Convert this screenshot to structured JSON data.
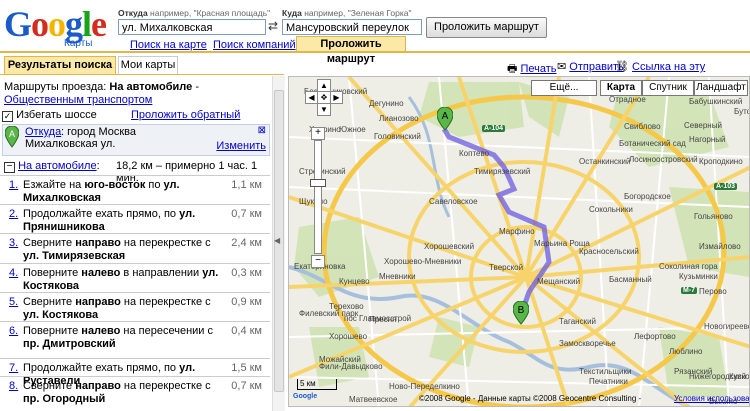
{
  "logo": {
    "word": "Google",
    "sub": "Карты"
  },
  "route": {
    "from_label": "Откуда",
    "from_hint": "например, \"Красная площадь\"",
    "from_value": "ул. Михалковская",
    "to_label": "Куда",
    "to_hint": "например, \"Зеленая Горка\"",
    "to_value": "Мансуровский переулок",
    "swap_icon": "⇄",
    "submit": "Проложить маршрут"
  },
  "top_tabs": {
    "search_map": "Поиск на карте",
    "search_companies": "Поиск компаний",
    "route": "Проложить маршрут"
  },
  "left_tabs": {
    "results": "Результаты поиска",
    "my_maps": "Мои карты"
  },
  "route_modes": {
    "label": "Маршруты проезда:",
    "car": "На автомобиле",
    "dash": " - ",
    "transit": "Общественным транспортом"
  },
  "avoid_highways": {
    "label": "Избегать шоссе",
    "checked": true
  },
  "reverse_route": "Проложить обратный маршрут",
  "start": {
    "marker": "A",
    "link": "Откуда",
    "city": ": город Москва",
    "street": "Михалковская ул.",
    "edit": "Изменить",
    "close": "⊠"
  },
  "summary": {
    "mode": "На автомобиле",
    "colon": ":",
    "distance": "18,2 км – примерно 1 час. 1 мин.",
    "collapse": "−"
  },
  "steps": [
    {
      "n": "1.",
      "text": "Езжайте на <b>юго-восток</b> по <b>ул. Михалковская</b>",
      "dist": "1,1 км"
    },
    {
      "n": "2.",
      "text": "Продолжайте ехать прямо, по <b>ул. Прянишникова</b>",
      "dist": "0,7 км"
    },
    {
      "n": "3.",
      "text": "Сверните <b>направо</b> на перекрестке с <b>ул. Тимирязевская</b>",
      "dist": "2,4 км"
    },
    {
      "n": "4.",
      "text": "Поверните <b>налево</b> в направлении <b>ул. Костякова</b>",
      "dist": "0,3 км"
    },
    {
      "n": "5.",
      "text": "Сверните <b>направо</b> на перекрестке с <b>ул. Костякова</b>",
      "dist": "0,9 км"
    },
    {
      "n": "6.",
      "text": "Поверните <b>налево</b> на пересечении с <b>пр. Дмитровский</b>",
      "dist": "0,4 км"
    },
    {
      "n": "7.",
      "text": "Продолжайте ехать прямо, по <b>ул. Руставели</b>",
      "dist": "1,5 км"
    },
    {
      "n": "8.",
      "text": "Сверните <b>направо</b> на перекрестке с <b>пр. Огородный</b>",
      "dist": "0,7 км"
    }
  ],
  "right_links": {
    "print": "Печать",
    "send": "Отправить",
    "link": "Ссылка на эту страницу"
  },
  "map": {
    "more": "Ещё...",
    "types": [
      "Карта",
      "Спутник",
      "Ландшафт"
    ],
    "active_type": "Карта",
    "scale": "5 км",
    "copyright": "©2008 Google - Данные карты ©2008 Geocentre Consulting -",
    "terms": "Условия использования",
    "marker_a": "A",
    "marker_b": "B",
    "labels": [
      "Северный",
      "Нагорный",
      "Бабушкинский",
      "Отрадное",
      "Бутово",
      "Свиблово",
      "Ботанический сад",
      "Лосиноостровский",
      "Кроподкино",
      "Бескудниковский",
      "Дегунино",
      "Лианозово",
      "Головинский",
      "Коптево",
      "Тимирязевский",
      "Останкинский",
      "Ховрино",
      "Южное",
      "Савеловское",
      "Марфино",
      "Строгинский",
      "Хорошевский",
      "Хорошево-Мневники",
      "Мневники",
      "Щукино",
      "Марьина Роща",
      "Пресня",
      "Сокольники",
      "Богородское",
      "Гольяново",
      "Измайлово",
      "Соколиная гора",
      "Перово",
      "Новогиреево",
      "Хорошево",
      "Тверской",
      "Мещанский",
      "Красносельский",
      "Басманный",
      "Лефортово",
      "Кунцево",
      "пос Главмосстрой",
      "Терехово",
      "Таганский",
      "Замоскворечье",
      "Филевский парк",
      "Фили-Давыдково",
      "Рязанский",
      "Кузьминки",
      "Печатники",
      "Текстильщики",
      "Нижегородский",
      "Выхино",
      "Люблино",
      "Матвеевское",
      "Екатериновка",
      "Кусково",
      "Можайский",
      "Ново-Переделкино"
    ],
    "roads": [
      "A-104",
      "A-103",
      "M-7"
    ]
  }
}
